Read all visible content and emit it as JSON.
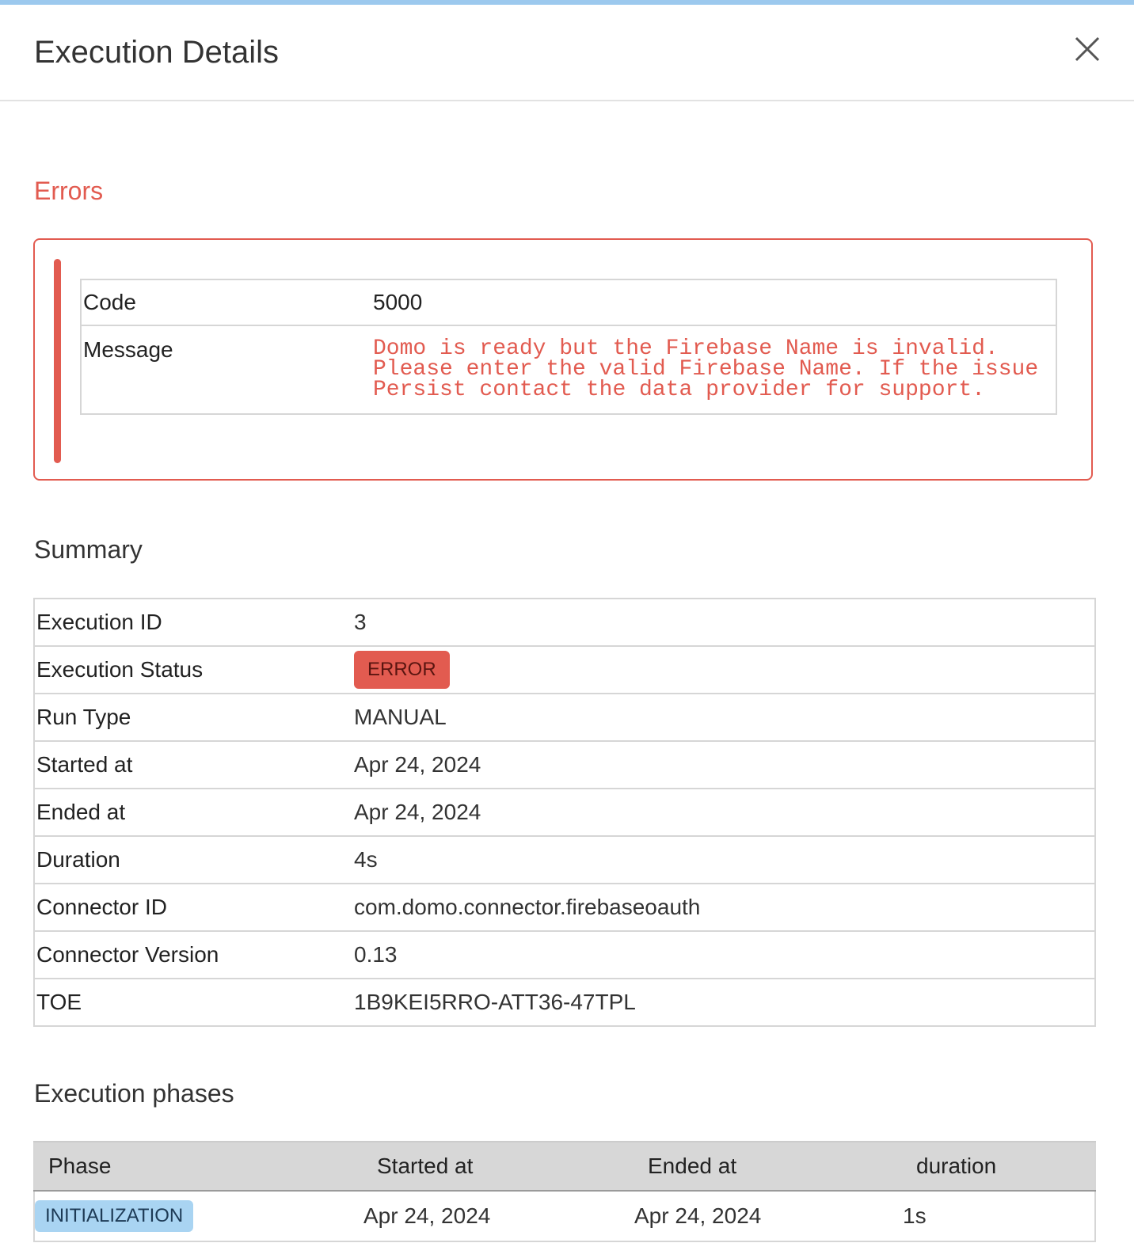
{
  "modal": {
    "title": "Execution Details"
  },
  "errors": {
    "heading": "Errors",
    "code_label": "Code",
    "code_value": "5000",
    "message_label": "Message",
    "message_value": "Domo is ready but the Firebase Name is invalid.\nPlease enter the valid Firebase Name. If the issue\nPersist contact the data provider for support."
  },
  "summary": {
    "heading": "Summary",
    "rows": [
      {
        "label": "Execution ID",
        "value": "3"
      },
      {
        "label": "Execution Status",
        "value": "ERROR"
      },
      {
        "label": "Run Type",
        "value": "MANUAL"
      },
      {
        "label": "Started at",
        "value": "Apr 24, 2024"
      },
      {
        "label": "Ended at",
        "value": "Apr 24, 2024"
      },
      {
        "label": "Duration",
        "value": "4s"
      },
      {
        "label": "Connector ID",
        "value": "com.domo.connector.firebaseoauth"
      },
      {
        "label": "Connector Version",
        "value": "0.13"
      },
      {
        "label": "TOE",
        "value": "1B9KEI5RRO-ATT36-47TPL"
      }
    ]
  },
  "phases": {
    "heading": "Execution phases",
    "columns": [
      "Phase",
      "Started at",
      "Ended at",
      "duration"
    ],
    "rows": [
      {
        "phase": "INITIALIZATION",
        "started": "Apr 24, 2024",
        "ended": "Apr 24, 2024",
        "duration": "1s"
      }
    ]
  },
  "colors": {
    "accent_top": "#9cc9ee",
    "error_red": "#e25b50",
    "phase_badge": "#a9d4f2"
  },
  "icons": {
    "close": "close-icon"
  }
}
